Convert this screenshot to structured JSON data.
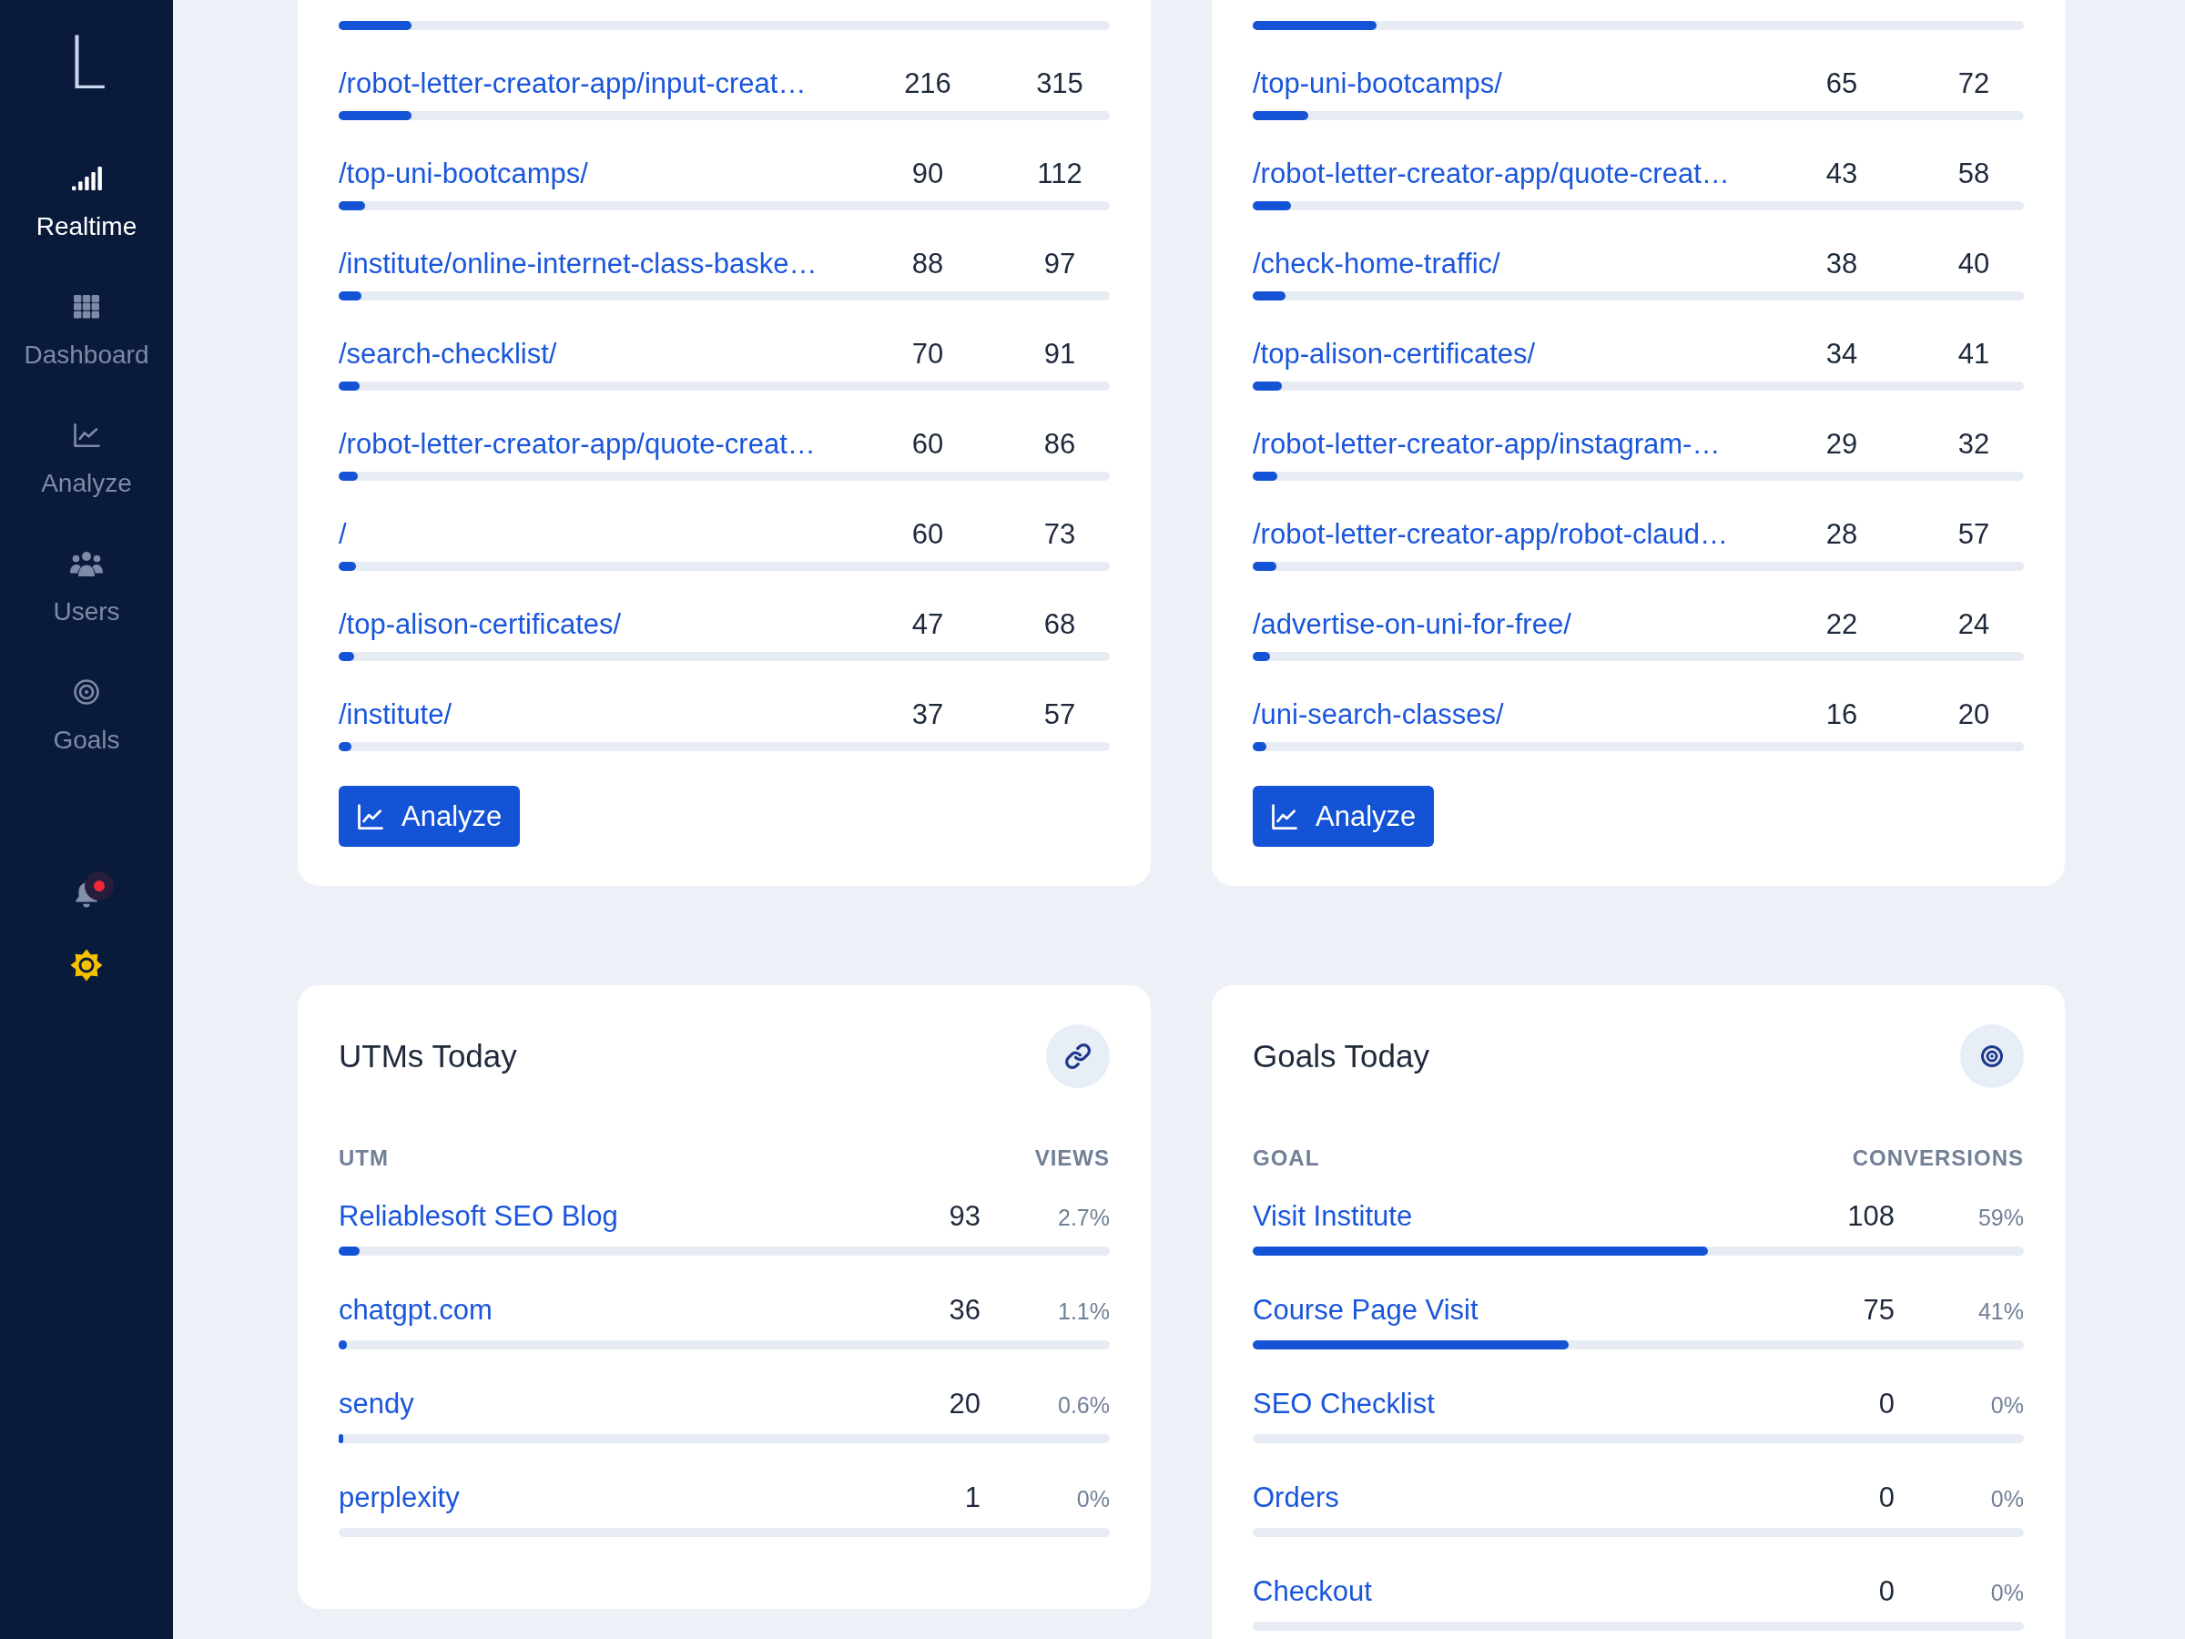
{
  "sidebar": {
    "logo": "L",
    "items": [
      {
        "label": "Realtime",
        "selected": true
      },
      {
        "label": "Dashboard",
        "selected": false
      },
      {
        "label": "Analyze",
        "selected": false
      },
      {
        "label": "Users",
        "selected": false
      },
      {
        "label": "Goals",
        "selected": false
      }
    ],
    "notifications": {
      "unread": true
    }
  },
  "page_cards": [
    {
      "rows": [
        {
          "level": 0.095
        },
        {
          "label": "/robot-letter-creator-app/input-creat…",
          "column_2": "216",
          "column_3": "315",
          "level": 0.094
        },
        {
          "label": "/top-uni-bootcamps/",
          "column_2": "90",
          "column_3": "112",
          "level": 0.034
        },
        {
          "label": "/institute/online-internet-class-baske…",
          "column_2": "88",
          "column_3": "97",
          "level": 0.029
        },
        {
          "label": "/search-checklist/",
          "column_2": "70",
          "column_3": "91",
          "level": 0.027
        },
        {
          "label": "/robot-letter-creator-app/quote-creat…",
          "column_2": "60",
          "column_3": "86",
          "level": 0.025
        },
        {
          "label": "/",
          "column_2": "60",
          "column_3": "73",
          "level": 0.022
        },
        {
          "label": "/top-alison-certificates/",
          "column_2": "47",
          "column_3": "68",
          "level": 0.02
        },
        {
          "label": "/institute/",
          "column_2": "37",
          "column_3": "57",
          "level": 0.016
        }
      ],
      "button": "Analyze"
    },
    {
      "rows": [
        {
          "level": 0.16
        },
        {
          "label": "/top-uni-bootcamps/",
          "column_2": "65",
          "column_3": "72",
          "level": 0.072
        },
        {
          "label": "/robot-letter-creator-app/quote-creat…",
          "column_2": "43",
          "column_3": "58",
          "level": 0.049
        },
        {
          "label": "/check-home-traffic/",
          "column_2": "38",
          "column_3": "40",
          "level": 0.042
        },
        {
          "label": "/top-alison-certificates/",
          "column_2": "34",
          "column_3": "41",
          "level": 0.038
        },
        {
          "label": "/robot-letter-creator-app/instagram-…",
          "column_2": "29",
          "column_3": "32",
          "level": 0.032
        },
        {
          "label": "/robot-letter-creator-app/robot-claud…",
          "column_2": "28",
          "column_3": "57",
          "level": 0.031
        },
        {
          "label": "/advertise-on-uni-for-free/",
          "column_2": "22",
          "column_3": "24",
          "level": 0.023
        },
        {
          "label": "/uni-search-classes/",
          "column_2": "16",
          "column_3": "20",
          "level": 0.018
        }
      ],
      "button": "Analyze"
    }
  ],
  "utms_card": {
    "title": "UTMs Today",
    "columns": [
      "UTM",
      "VIEWS"
    ],
    "rows": [
      {
        "label": "Reliablesoft SEO Blog",
        "count": "93",
        "share": "2.7%",
        "level": 0.027
      },
      {
        "label": "chatgpt.com",
        "count": "36",
        "share": "1.1%",
        "level": 0.011
      },
      {
        "label": "sendy",
        "count": "20",
        "share": "0.6%",
        "level": 0.006
      },
      {
        "label": "perplexity",
        "count": "1",
        "share": "0%"
      }
    ]
  },
  "goals_card": {
    "title": "Goals Today",
    "columns": [
      "GOAL",
      "CONVERSIONS"
    ],
    "rows": [
      {
        "label": "Visit Institute",
        "count": "108",
        "share": "59%",
        "level": 0.59
      },
      {
        "label": "Course Page Visit",
        "count": "75",
        "share": "41%",
        "level": 0.41
      },
      {
        "label": "SEO Checklist",
        "count": "0",
        "share": "0%"
      },
      {
        "label": "Orders",
        "count": "0",
        "share": "0%"
      },
      {
        "label": "Checkout",
        "count": "0",
        "share": "0%"
      }
    ]
  }
}
